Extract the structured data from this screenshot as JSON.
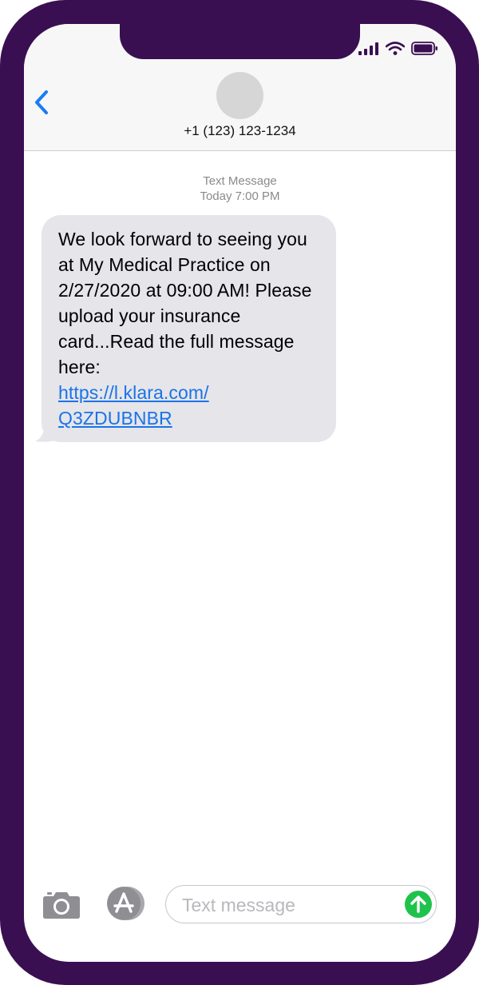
{
  "header": {
    "contact": "+1 (123) 123-1234"
  },
  "thread": {
    "service": "Text Message",
    "timestamp": "Today 7:00 PM"
  },
  "message": {
    "text": "We look forward to seeing you at My Medical Practice on 2/27/2020 at 09:00 AM! Please upload your insurance card...Read the full message here:",
    "link_line_1": "https://l.klara.com/",
    "link_line_2": "Q3ZDUBNBR"
  },
  "composer": {
    "placeholder": "Text message"
  },
  "colors": {
    "frame": "#3a0f52",
    "bubble": "#e5e5ea",
    "link": "#1a73e8",
    "accent_blue": "#1a7cf5",
    "send": "#1fc34c"
  },
  "icons": {
    "back": "chevron-left-icon",
    "camera": "camera-icon",
    "apps": "app-store-icon",
    "send": "send-arrow-icon",
    "signal": "signal-icon",
    "wifi": "wifi-icon",
    "battery": "battery-icon"
  }
}
